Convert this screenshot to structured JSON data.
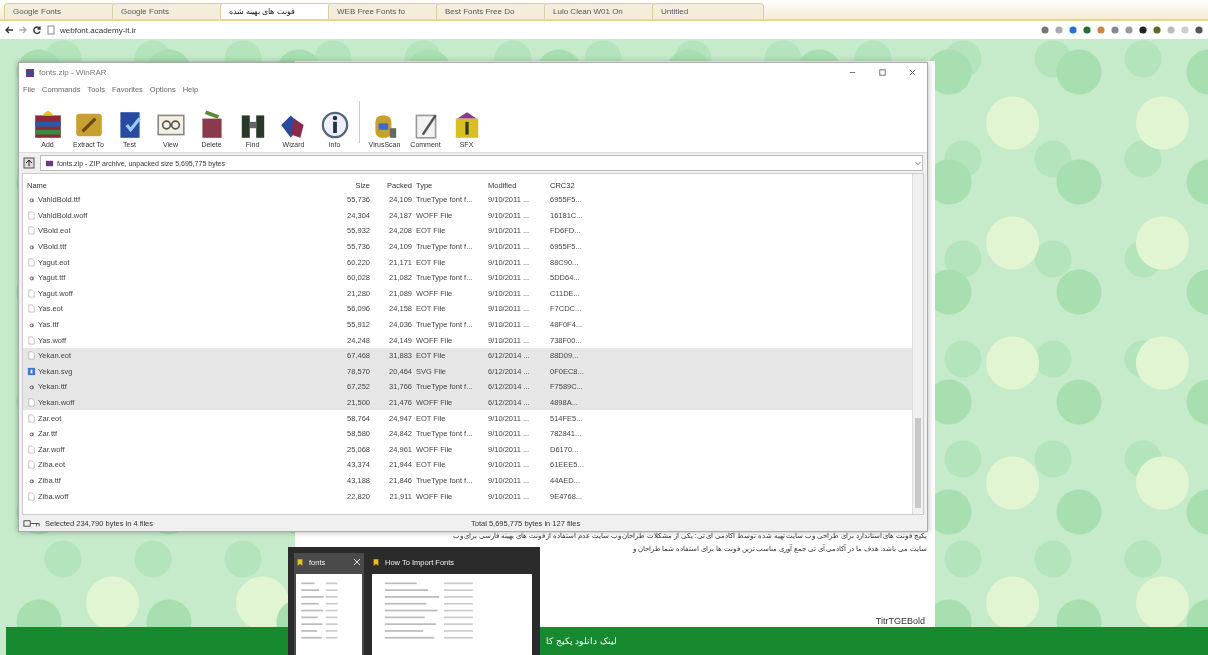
{
  "browser": {
    "tabs": [
      {
        "label": "Google Fonts",
        "selected": false
      },
      {
        "label": "Google Fonts",
        "selected": false
      },
      {
        "label": "فونت های بهینه شده",
        "selected": true
      },
      {
        "label": "WEB Free Fonts fo",
        "selected": false
      },
      {
        "label": "Best Fonts Free Do",
        "selected": false
      },
      {
        "label": "Lulo Clean W01 On",
        "selected": false
      },
      {
        "label": "Untitled",
        "selected": false
      }
    ],
    "address": "webfont.academy-it.ir"
  },
  "page": {
    "paragraph": [
      "پکیج فونت های استاندارد برای طراحی وب سایت تهیه شده توسط آکادمی آی تی: یکی از مشکلات طراحان وب سایت عدم استفاده از فونت های بهینه فارسی برای وب",
      "سایت می باشد. هدف ما در آکادمی آی تی جمع آوری مناسب ترین فونت ها برای استفاده شما طراحان و"
    ],
    "heading": "TitrTGEBold",
    "banner": "لینک دانلود پکیج کا"
  },
  "winrar": {
    "title": "fonts.zip - WinRAR",
    "menu": [
      "File",
      "Commands",
      "Tools",
      "Favorites",
      "Options",
      "Help"
    ],
    "toolbar": [
      "Add",
      "Extract To",
      "Test",
      "View",
      "Delete",
      "Find",
      "Wizard",
      "Info",
      "VirusScan",
      "Comment",
      "SFX"
    ],
    "path": "fonts.zip - ZIP archive, unpacked size 5,695,775 bytes",
    "columns": [
      "Name",
      "Size",
      "Packed",
      "Type",
      "Modified",
      "CRC32"
    ],
    "files": [
      {
        "kind": "font",
        "name": "VahidBold.ttf",
        "size": "55,736",
        "packed": "24,109",
        "type": "TrueType font f...",
        "modified": "9/10/2011 ...",
        "crc": "6955F5...",
        "selected": false
      },
      {
        "kind": "document",
        "name": "VahidBold.woff",
        "size": "24,304",
        "packed": "24,187",
        "type": "WOFF File",
        "modified": "9/10/2011 ...",
        "crc": "16181C...",
        "selected": false
      },
      {
        "kind": "document",
        "name": "VBold.eot",
        "size": "55,932",
        "packed": "24,208",
        "type": "EOT File",
        "modified": "9/10/2011 ...",
        "crc": "FD6FD...",
        "selected": false
      },
      {
        "kind": "font",
        "name": "VBold.ttf",
        "size": "55,736",
        "packed": "24,109",
        "type": "TrueType font f...",
        "modified": "9/10/2011 ...",
        "crc": "6955F5...",
        "selected": false
      },
      {
        "kind": "document",
        "name": "Yagut.eot",
        "size": "60,220",
        "packed": "21,171",
        "type": "EOT File",
        "modified": "9/10/2011 ...",
        "crc": "88C90...",
        "selected": false
      },
      {
        "kind": "font",
        "name": "Yagut.ttf",
        "size": "60,028",
        "packed": "21,082",
        "type": "TrueType font f...",
        "modified": "9/10/2011 ...",
        "crc": "5DD64...",
        "selected": false
      },
      {
        "kind": "document",
        "name": "Yagut.woff",
        "size": "21,280",
        "packed": "21,089",
        "type": "WOFF File",
        "modified": "9/10/2011 ...",
        "crc": "C11DE...",
        "selected": false
      },
      {
        "kind": "document",
        "name": "Yas.eot",
        "size": "56,096",
        "packed": "24,158",
        "type": "EOT File",
        "modified": "9/10/2011 ...",
        "crc": "F7CDC...",
        "selected": false
      },
      {
        "kind": "font",
        "name": "Yas.ttf",
        "size": "55,912",
        "packed": "24,036",
        "type": "TrueType font f...",
        "modified": "9/10/2011 ...",
        "crc": "48F0F4...",
        "selected": false
      },
      {
        "kind": "document",
        "name": "Yas.woff",
        "size": "24,248",
        "packed": "24,149",
        "type": "WOFF File",
        "modified": "9/10/2011 ...",
        "crc": "738F00...",
        "selected": false
      },
      {
        "kind": "document",
        "name": "Yekan.eot",
        "size": "67,468",
        "packed": "31,883",
        "type": "EOT File",
        "modified": "6/12/2014 ...",
        "crc": "88D09...",
        "selected": true
      },
      {
        "kind": "image",
        "name": "Yekan.svg",
        "size": "78,570",
        "packed": "20,464",
        "type": "SVG File",
        "modified": "6/12/2014 ...",
        "crc": "0F0EC8...",
        "selected": true
      },
      {
        "kind": "font",
        "name": "Yekan.ttf",
        "size": "67,252",
        "packed": "31,766",
        "type": "TrueType font f...",
        "modified": "6/12/2014 ...",
        "crc": "F7589C...",
        "selected": true
      },
      {
        "kind": "document",
        "name": "Yekan.woff",
        "size": "21,500",
        "packed": "21,476",
        "type": "WOFF File",
        "modified": "6/12/2014 ...",
        "crc": "4898A...",
        "selected": true
      },
      {
        "kind": "document",
        "name": "Zar.eot",
        "size": "58,764",
        "packed": "24,947",
        "type": "EOT File",
        "modified": "9/10/2011 ...",
        "crc": "514FE5...",
        "selected": false
      },
      {
        "kind": "font",
        "name": "Zar.ttf",
        "size": "58,580",
        "packed": "24,842",
        "type": "TrueType font f...",
        "modified": "9/10/2011 ...",
        "crc": "782841...",
        "selected": false
      },
      {
        "kind": "document",
        "name": "Zar.woff",
        "size": "25,068",
        "packed": "24,961",
        "type": "WOFF File",
        "modified": "9/10/2011 ...",
        "crc": "D6170...",
        "selected": false
      },
      {
        "kind": "document",
        "name": "Ziba.eot",
        "size": "43,374",
        "packed": "21,944",
        "type": "EOT File",
        "modified": "9/10/2011 ...",
        "crc": "61EEE5...",
        "selected": false
      },
      {
        "kind": "font",
        "name": "Ziba.ttf",
        "size": "43,188",
        "packed": "21,846",
        "type": "TrueType font f...",
        "modified": "9/10/2011 ...",
        "crc": "44AED...",
        "selected": false
      },
      {
        "kind": "document",
        "name": "Ziba.woff",
        "size": "22,820",
        "packed": "21,911",
        "type": "WOFF File",
        "modified": "9/10/2011 ...",
        "crc": "9E4768...",
        "selected": false
      }
    ],
    "status_left": "Selected 234,790 bytes in 4 files",
    "status_right": "Total 5,695,775 bytes in 127 files"
  },
  "taskbar_preview": [
    {
      "title": "fonts",
      "active": true
    },
    {
      "title": "How To Import Fonts",
      "active": false
    }
  ]
}
